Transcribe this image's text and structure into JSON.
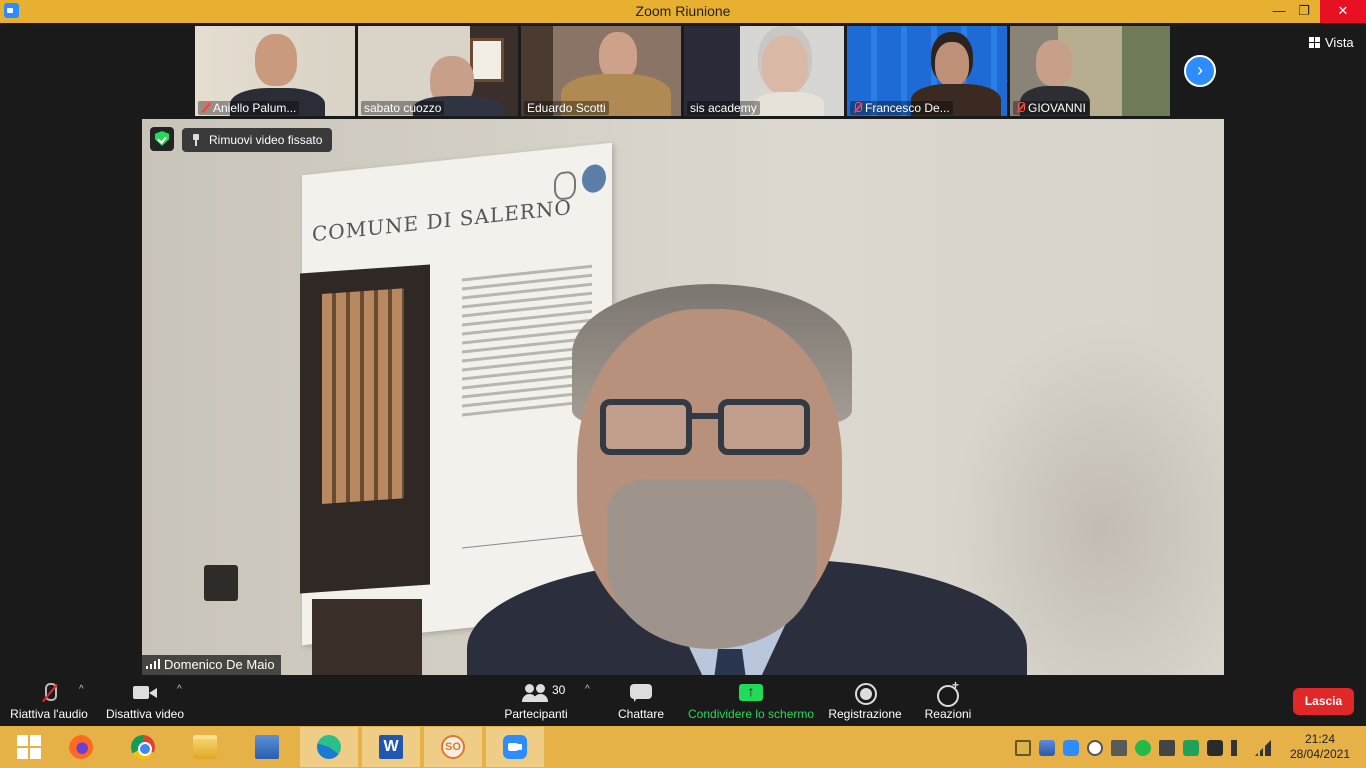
{
  "window": {
    "title": "Zoom Riunione",
    "minimize_glyph": "—",
    "restore_glyph": "❐",
    "close_glyph": "✕"
  },
  "view_button": "Vista",
  "next_page_glyph": "›",
  "participants_strip": [
    {
      "name": "Aniello Palum...",
      "muted": true
    },
    {
      "name": "sabato cuozzo",
      "muted": false
    },
    {
      "name": "Eduardo Scotti",
      "muted": false
    },
    {
      "name": "sis academy",
      "muted": false
    },
    {
      "name": "Francesco De...",
      "muted": true
    },
    {
      "name": "GIOVANNI",
      "muted": true
    }
  ],
  "main_video": {
    "speaker_name": "Domenico De Maio",
    "unpin_label": "Rimuovi video fissato",
    "poster_title": "COMUNE DI SALERNO"
  },
  "controls": {
    "audio": {
      "label": "Riattiva l'audio",
      "icon": "mic-muted-icon"
    },
    "video": {
      "label": "Disattiva video",
      "icon": "camera-icon"
    },
    "participants": {
      "label": "Partecipanti",
      "count": "30",
      "icon": "participants-icon"
    },
    "chat": {
      "label": "Chattare",
      "icon": "chat-icon"
    },
    "share": {
      "label": "Condividere lo schermo",
      "icon": "share-screen-icon",
      "color": "#23d959"
    },
    "record": {
      "label": "Registrazione",
      "icon": "record-icon"
    },
    "reactions": {
      "label": "Reazioni",
      "icon": "reactions-icon"
    },
    "caret_glyph": "^",
    "leave": {
      "label": "Lascia",
      "color": "#e02828"
    }
  },
  "taskbar": {
    "apps": [
      "start",
      "firefox",
      "chrome",
      "file-explorer",
      "remote-desktop",
      "edge",
      "word",
      "so",
      "zoom"
    ],
    "word_letter": "W",
    "so_text": "SO",
    "time": "21:24",
    "date": "28/04/2021"
  },
  "colors": {
    "titlebar": "#e8b030",
    "taskbar": "#e6b247",
    "zoom_blue": "#2d8cff"
  }
}
